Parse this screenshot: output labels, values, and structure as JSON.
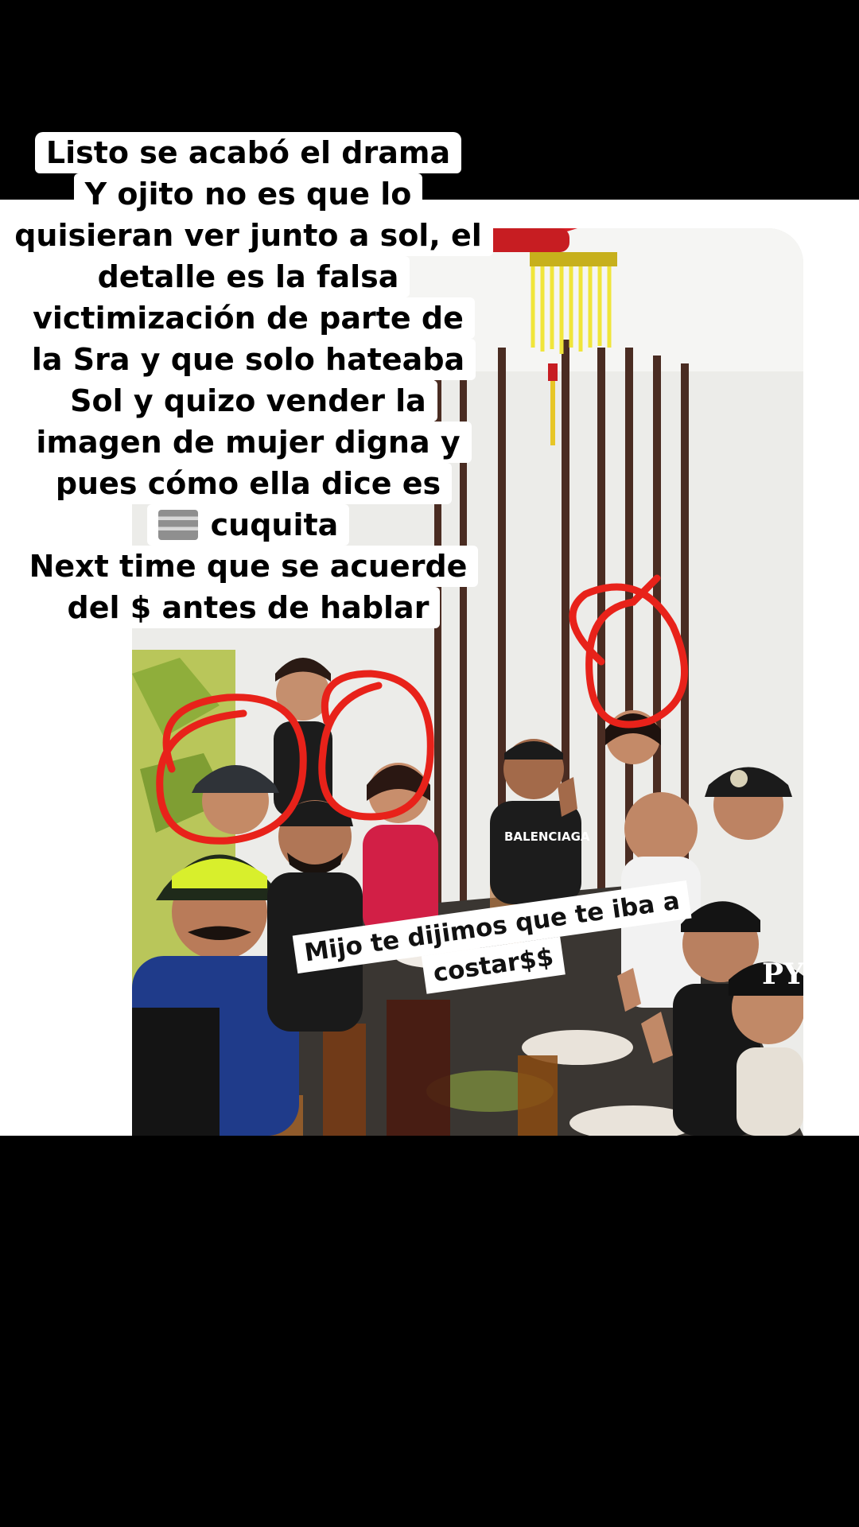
{
  "caption": {
    "lines": [
      "Listo se acabó el drama",
      "Y ojito no es que lo",
      "quisieran ver junto a sol, el",
      "detalle es la falsa",
      "victimización de parte de",
      "la Sra y que solo hateaba",
      "Sol y quizo vender la",
      "imagen de mujer digna y",
      "pues cómo ella dice es",
      "cuquita",
      "Next time que se acuerde",
      "del $ antes de hablar"
    ]
  },
  "overlay": {
    "line1": "Mijo te dijimos que te iba a",
    "line2": "costar$$"
  },
  "colors": {
    "circle_marks": "#e8221a",
    "background": "#000000",
    "band": "#ffffff"
  }
}
